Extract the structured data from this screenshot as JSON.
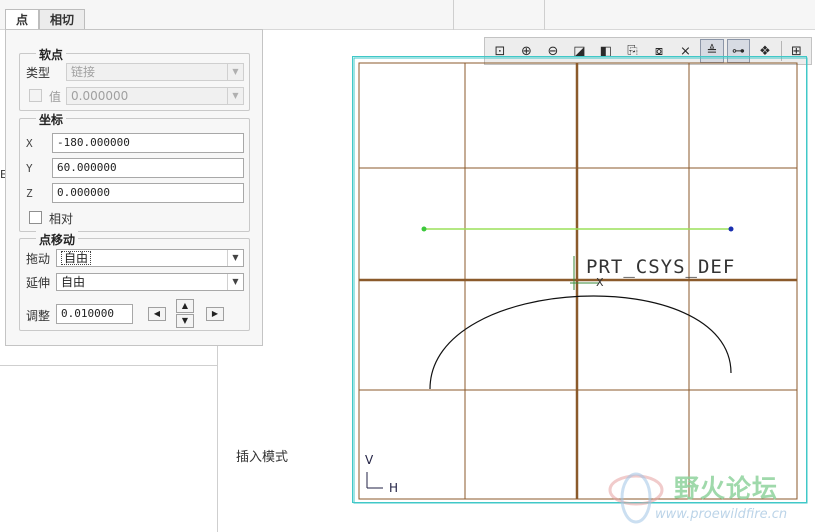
{
  "tabs": [
    {
      "label": "点"
    },
    {
      "label": "相切"
    }
  ],
  "soft_point": {
    "title": "软点",
    "type_label": "类型",
    "type_value": "链接",
    "value_label": "值",
    "value_value": "0.000000"
  },
  "coords": {
    "title": "坐标",
    "x_label": "X",
    "x_value": "-180.000000",
    "y_label": "Y",
    "y_value": "60.000000",
    "z_label": "Z",
    "z_value": "0.000000",
    "relative_label": "相对"
  },
  "point_move": {
    "title": "点移动",
    "drag_label": "拖动",
    "drag_value": "自由",
    "extend_label": "延伸",
    "extend_value": "自由",
    "adjust_label": "调整",
    "adjust_value": "0.010000"
  },
  "background": {
    "insert_mode": "插入模式",
    "fragment": "E"
  },
  "toolbar": [
    {
      "icon": "refit-icon",
      "glyph": "⊡"
    },
    {
      "icon": "zoom-in-icon",
      "glyph": "⊕"
    },
    {
      "icon": "zoom-out-icon",
      "glyph": "⊖"
    },
    {
      "icon": "repaint-icon",
      "glyph": "◪"
    },
    {
      "icon": "display-style-icon",
      "glyph": "◧"
    },
    {
      "icon": "saved-views-icon",
      "glyph": "⎘"
    },
    {
      "icon": "capture-icon",
      "glyph": "⧇"
    },
    {
      "icon": "constraints-display-icon",
      "glyph": "⨯"
    },
    {
      "icon": "dimension-display-icon",
      "glyph": "≜"
    },
    {
      "icon": "vertex-display-icon",
      "glyph": "⊶"
    },
    {
      "icon": "appearance-icon",
      "glyph": "❖"
    },
    {
      "icon": "grid-icon",
      "glyph": "⊞"
    }
  ],
  "graphics": {
    "csys_label": "PRT_CSYS_DEF",
    "axis_v": "V",
    "axis_h": "H",
    "axis_x": "X"
  },
  "watermark": {
    "title": "野火论坛",
    "url": "www.proewildfire.cn"
  },
  "colors": {
    "grid": "#8b5a2b",
    "sketch_line": "#9be05a",
    "frame": "#40c8c8"
  }
}
